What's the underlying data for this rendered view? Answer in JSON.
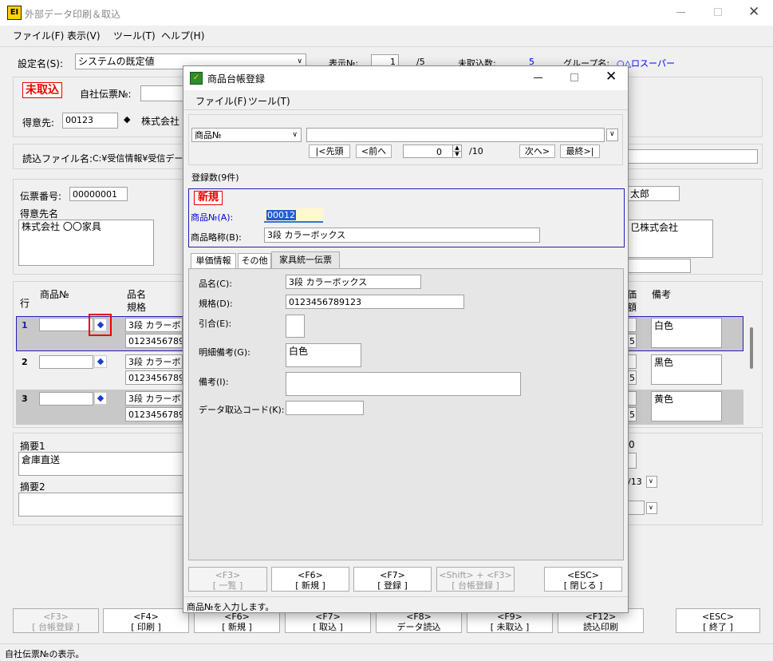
{
  "main_window": {
    "title": "外部データ印刷＆取込",
    "icon_text": "EI",
    "menu": [
      "ファイル(F)",
      "表示(V)",
      "ツール(T)",
      "ヘルプ(H)"
    ],
    "settings_label": "設定名(S):",
    "settings_value": "システムの既定値",
    "display_no_label": "表示№:",
    "display_no_value": "1",
    "display_no_total": "/5",
    "uncaptured_label": "未取込数:",
    "uncaptured_value": "5",
    "group_label": "グループ名:",
    "group_value": "○△ロスーパー",
    "status_stamp": "未取込",
    "company_slip_label": "自社伝票№:",
    "customer_label": "得意先:",
    "customer_code": "00123",
    "customer_name": "株式会社",
    "file_label": "読込ファイル名:",
    "file_value": "C:¥受信情報¥受信デー",
    "slip_no_label": "伝票番号:",
    "slip_no_value": "00000001",
    "customer_name_label": "得意先名",
    "customer_name_value": "株式会社 〇〇家具",
    "right_person": "太郎",
    "right_company": "⺋株式会社",
    "grid_headers": {
      "row": "行",
      "product_no": "商品№",
      "item_name": "品名",
      "spec": "規格",
      "price": "価",
      "amount": "額",
      "remarks": "備考"
    },
    "rows": [
      {
        "no": "1",
        "name": "3段 カラーボッ",
        "spec": "01234567891",
        "price_tail": "5",
        "remark": "白色"
      },
      {
        "no": "2",
        "name": "3段 カラーボッ",
        "spec": "01234567891",
        "price_tail": "5",
        "remark": "黒色"
      },
      {
        "no": "3",
        "name": "3段 カラーボッ",
        "spec": "01234567891",
        "price_tail": "5",
        "remark": "黄色"
      }
    ],
    "summary1_label": "摘要1",
    "summary1_value": "倉庫直送",
    "summary2_label": "摘要2",
    "right_zero": "0",
    "right_date": "/13",
    "fkeys": [
      {
        "key": "<F3>",
        "label": "[ 台帳登録 ]",
        "disabled": true
      },
      {
        "key": "<F4>",
        "label": "[ 印刷 ]"
      },
      {
        "key": "<F6>",
        "label": "[ 新規 ]"
      },
      {
        "key": "<F7>",
        "label": "[ 取込 ]"
      },
      {
        "key": "<F8>",
        "label": "データ読込"
      },
      {
        "key": "<F9>",
        "label": "[ 未取込 ]"
      },
      {
        "key": "<F12>",
        "label": "読込印刷"
      },
      {
        "key": "<ESC>",
        "label": "[ 終了 ]"
      }
    ],
    "status_bar": "自社伝票№の表示。"
  },
  "dialog": {
    "title": "商品台帳登録",
    "menu": [
      "ファイル(F)",
      "ツール(T)"
    ],
    "search_select": "商品№",
    "search_value": "",
    "nav_first": "|<先頭",
    "nav_prev": "<前へ",
    "nav_page": "0",
    "nav_total": "/10",
    "nav_next": "次へ>",
    "nav_last": "最終>|",
    "count_label": "登録数(9件)",
    "new_stamp": "新規",
    "product_no_label": "商品№(A):",
    "product_no_value": "00012",
    "short_name_label": "商品略称(B):",
    "short_name_value": "3段 カラーボックス",
    "tabs": [
      "単価情報",
      "その他",
      "家具統一伝票"
    ],
    "fields": [
      {
        "label": "品名(C):",
        "value": "3段 カラーボックス"
      },
      {
        "label": "規格(D):",
        "value": "0123456789123"
      },
      {
        "label": "引合(E):",
        "value": ""
      },
      {
        "label": "明細備考(G):",
        "value": "白色"
      },
      {
        "label": "備考(I):",
        "value": ""
      },
      {
        "label": "データ取込コード(K):",
        "value": ""
      }
    ],
    "buttons": [
      {
        "key": "<F3>",
        "label": "[ 一覧 ]",
        "disabled": true
      },
      {
        "key": "<F6>",
        "label": "[ 新規 ]"
      },
      {
        "key": "<F7>",
        "label": "[ 登録 ]"
      },
      {
        "key": "<Shift> + <F3>",
        "label": "[ 台帳登録 ]",
        "disabled": true
      },
      {
        "key": "<ESC>",
        "label": "[ 閉じる ]"
      }
    ],
    "status": "商品№を入力します。"
  },
  "colors": {
    "accent": "#0000ee",
    "stamp": "#e00000",
    "dialog_border": "#1f1fb5"
  }
}
